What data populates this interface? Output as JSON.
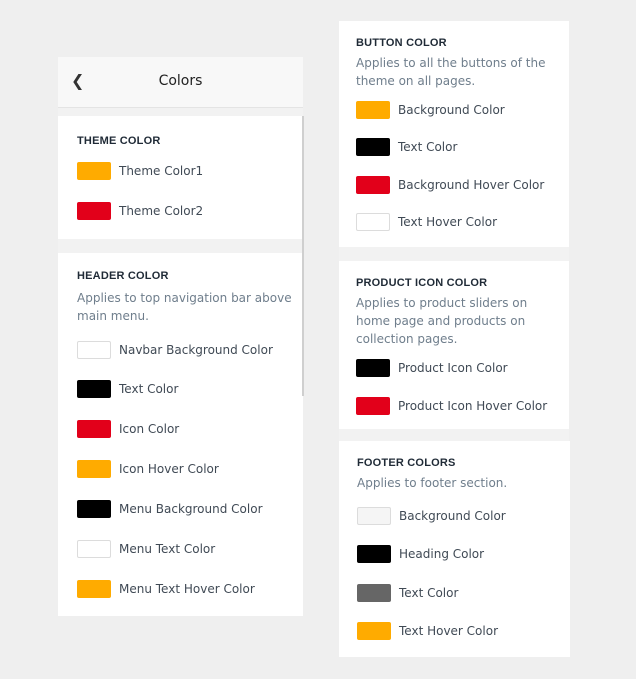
{
  "header": {
    "back_icon": "chevron-left-icon",
    "title": "Colors"
  },
  "left": {
    "theme": {
      "title": "THEME COLOR",
      "items": [
        {
          "label": "Theme Color1",
          "color": "#ffab00"
        },
        {
          "label": "Theme Color2",
          "color": "#e2001a"
        }
      ]
    },
    "header_color": {
      "title": "HEADER COLOR",
      "description": "Applies to top navigation bar above main menu.",
      "items": [
        {
          "label": "Navbar Background Color",
          "color": "#ffffff"
        },
        {
          "label": "Text Color",
          "color": "#000000"
        },
        {
          "label": "Icon Color",
          "color": "#e2001a"
        },
        {
          "label": "Icon Hover Color",
          "color": "#ffab00"
        },
        {
          "label": "Menu Background Color",
          "color": "#000000"
        },
        {
          "label": "Menu Text Color",
          "color": "#ffffff"
        },
        {
          "label": "Menu Text Hover Color",
          "color": "#ffab00"
        }
      ]
    }
  },
  "right": {
    "button": {
      "title": "BUTTON COLOR",
      "description": "Applies to all the buttons of the theme on all pages.",
      "items": [
        {
          "label": "Background Color",
          "color": "#ffab00"
        },
        {
          "label": "Text Color",
          "color": "#000000"
        },
        {
          "label": "Background Hover Color",
          "color": "#e2001a"
        },
        {
          "label": "Text Hover Color",
          "color": "#ffffff"
        }
      ]
    },
    "product_icon": {
      "title": "PRODUCT ICON COLOR",
      "description": "Applies to product sliders on home page and products on collection pages.",
      "items": [
        {
          "label": "Product Icon Color",
          "color": "#000000"
        },
        {
          "label": "Product Icon Hover Color",
          "color": "#e2001a"
        }
      ]
    },
    "footer": {
      "title": "FOOTER COLORS",
      "description": "Applies to footer section.",
      "items": [
        {
          "label": "Background Color",
          "color": "#f5f5f5"
        },
        {
          "label": "Heading Color",
          "color": "#000000"
        },
        {
          "label": "Text Color",
          "color": "#666666"
        },
        {
          "label": "Text Hover Color",
          "color": "#ffab00"
        }
      ]
    }
  }
}
